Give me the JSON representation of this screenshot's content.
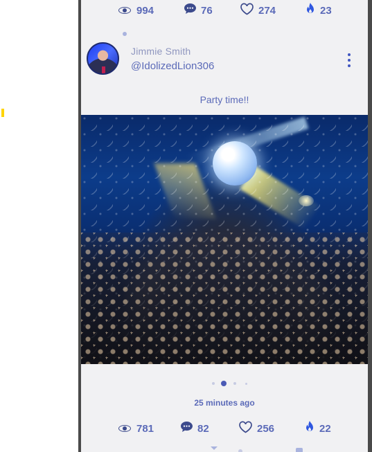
{
  "top_stats": {
    "views": "994",
    "comments": "76",
    "likes": "274",
    "fire": "23"
  },
  "post": {
    "author_name": "Jimmie Smith",
    "author_handle": "@IdolizedLion306",
    "caption": "Party time!!",
    "timestamp": "25 minutes ago",
    "carousel": {
      "count": 4,
      "active_index": 1
    },
    "stats": {
      "views": "781",
      "comments": "82",
      "likes": "256",
      "fire": "22"
    }
  },
  "icons": {
    "views": "eye-icon",
    "comments": "comment-bubble-icon",
    "likes": "heart-icon",
    "fire": "fire-icon",
    "menu": "more-vertical-icon"
  },
  "colors": {
    "accent": "#5b6ab8",
    "icon_dark": "#3c4a8c",
    "feed_background": "#f1f1f3",
    "divider": "#4a4a4a",
    "highlight_yellow": "#ffd400"
  }
}
